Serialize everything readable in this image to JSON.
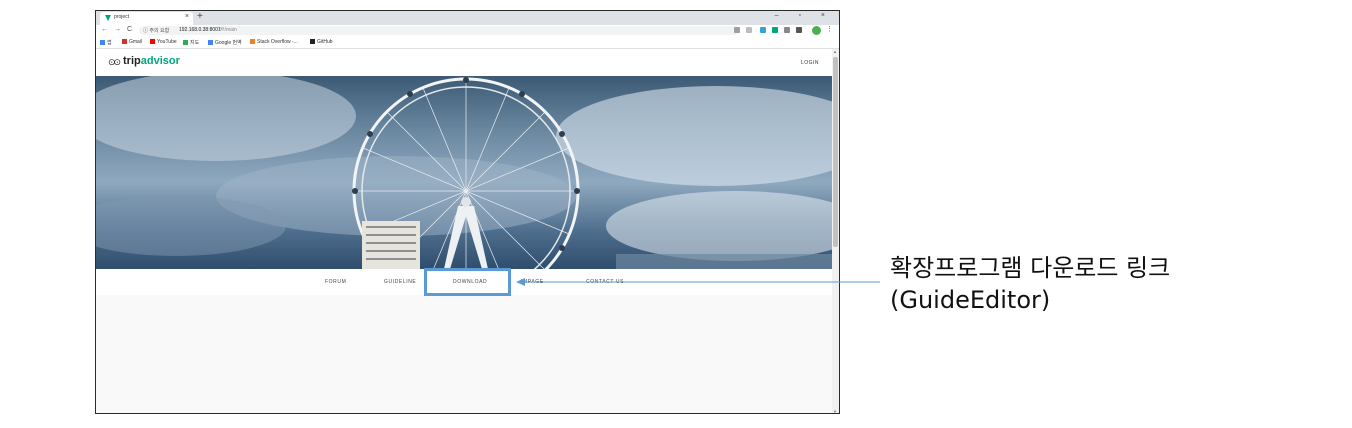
{
  "browser": {
    "tab_title": "project",
    "tab_close": "×",
    "new_tab": "+",
    "window_controls": "– ▫ ×",
    "nav": {
      "back": "←",
      "forward": "→",
      "reload": "C"
    },
    "security_label": "ⓘ 주의 요함",
    "url_host": "192.168.0.38:8001",
    "url_path": "/#!/main",
    "bookmarks": [
      {
        "label": "앱",
        "icon": "apps-icon",
        "color": "#4285f4"
      },
      {
        "label": "Gmail",
        "icon": "gmail-icon",
        "color": "#d93025"
      },
      {
        "label": "YouTube",
        "icon": "youtube-icon",
        "color": "#ff0000"
      },
      {
        "label": "지도",
        "icon": "maps-icon",
        "color": "#34a853"
      },
      {
        "label": "Google 번역",
        "icon": "translate-icon",
        "color": "#4285f4"
      },
      {
        "label": "Stack Overflow -...",
        "icon": "stackoverflow-icon",
        "color": "#f48024"
      },
      {
        "label": "GitHub",
        "icon": "github-icon",
        "color": "#222222"
      }
    ]
  },
  "site": {
    "logo_prefix": "trip",
    "logo_suffix": "advisor",
    "login": "LOGIN",
    "nav_items": [
      "FORUM",
      "GUIDELINE",
      "DOWNLOAD",
      "IMPAGE",
      "CONTACT US"
    ]
  },
  "annotation": {
    "line1": "확장프로그램 다운로드 링크",
    "line2": "(GuideEditor)",
    "color": "#5b9bd5"
  }
}
